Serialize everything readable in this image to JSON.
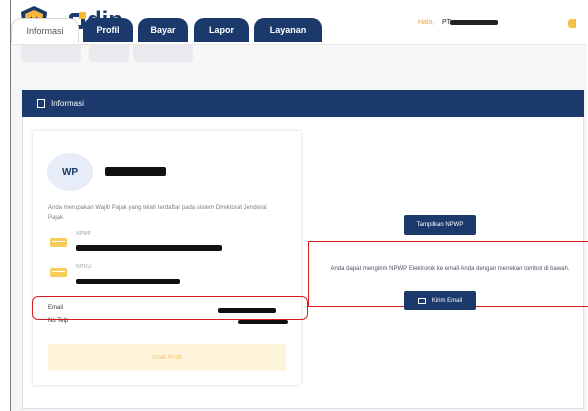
{
  "header": {
    "logo_text": "djp",
    "greeting": "Halo,",
    "company_prefix": "PT"
  },
  "tabs": [
    {
      "label": "Informasi",
      "active": true
    },
    {
      "label": "Profil",
      "active": false
    },
    {
      "label": "Bayar",
      "active": false
    },
    {
      "label": "Lapor",
      "active": false
    },
    {
      "label": "Layanan",
      "active": false
    }
  ],
  "section": {
    "title": "Informasi"
  },
  "profile": {
    "avatar_initials": "WP",
    "intro": "Anda merupakan Wajib Pajak yang telah terdaftar pada sistem Direktorat Jenderal Pajak.",
    "npwp_label": "NPWP",
    "nitku_label": "NITKU",
    "email_label": "Email",
    "phone_label": "No Telp",
    "change_profile_button": "Ubah Profil"
  },
  "actions": {
    "show_npwp_button": "Tampilkan NPWP",
    "send_description": "Anda dapat mengirim NPWP Elektronik ke email Anda dengan menekan tombol di bawah.",
    "send_email_button": "Kirim Email"
  },
  "colors": {
    "navy": "#1b3a6b",
    "accent_yellow": "#f8cc57",
    "highlight_red": "#d81e1e"
  }
}
